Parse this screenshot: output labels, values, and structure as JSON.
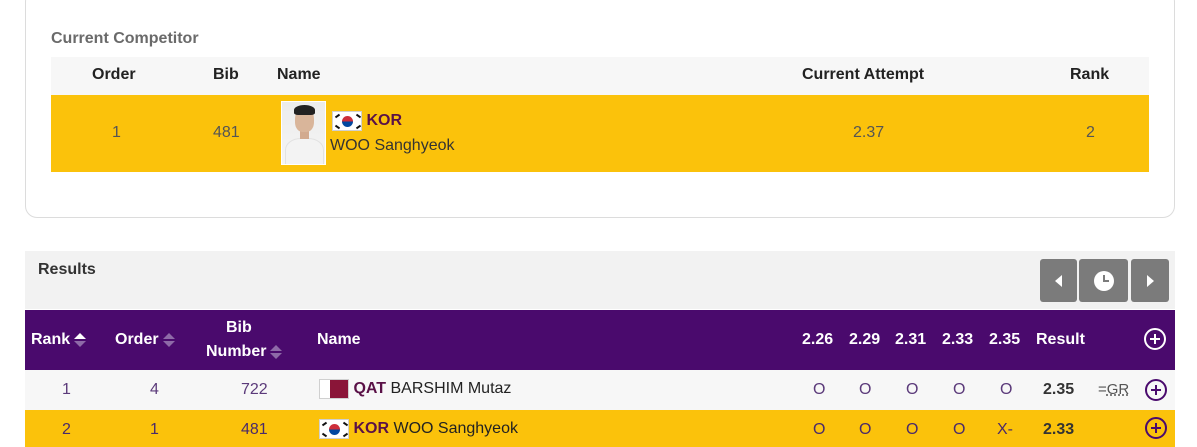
{
  "current": {
    "title": "Current Competitor",
    "headers": {
      "order": "Order",
      "bib": "Bib",
      "name": "Name",
      "attempt": "Current Attempt",
      "rank": "Rank"
    },
    "row": {
      "order": "1",
      "bib": "481",
      "noc": "KOR",
      "name": "WOO Sanghyeok",
      "attempt": "2.37",
      "rank": "2"
    }
  },
  "results": {
    "title": "Results",
    "nav": {
      "prev_icon": "caret-left-icon",
      "clock_icon": "clock-icon",
      "next_icon": "caret-right-icon"
    },
    "headers": {
      "rank": "Rank",
      "order": "Order",
      "bib_line1": "Bib",
      "bib_line2": "Number",
      "name": "Name",
      "heights": [
        "2.26",
        "2.29",
        "2.31",
        "2.33",
        "2.35"
      ],
      "result": "Result"
    },
    "rows": [
      {
        "rank": "1",
        "order": "4",
        "bib": "722",
        "noc": "QAT",
        "name": "BARSHIM Mutaz",
        "attempts": [
          "O",
          "O",
          "O",
          "O",
          "O"
        ],
        "result": "2.35",
        "note_prefix": "=",
        "note_abbr": "GR"
      },
      {
        "rank": "2",
        "order": "1",
        "bib": "481",
        "noc": "KOR",
        "name": "WOO Sanghyeok",
        "attempts": [
          "O",
          "O",
          "O",
          "O",
          "X-"
        ],
        "result": "2.33",
        "note_prefix": "",
        "note_abbr": ""
      }
    ]
  },
  "colors": {
    "header_purple": "#4a0a6d",
    "highlight_yellow": "#fbc20b",
    "noc_text": "#5a1147"
  }
}
